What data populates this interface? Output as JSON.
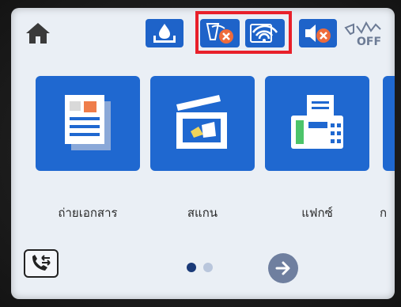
{
  "status_bar": {
    "home_icon": "home-icon",
    "ink_icon": "ink-level-icon",
    "wifi_direct_icon": "wifi-direct-disconnected-icon",
    "wifi_icon": "wifi-icon",
    "fax_sound_icon": "fax-sound-disabled-icon",
    "fax_off_label": "OFF"
  },
  "tiles": [
    {
      "label": "ถ่ายเอกสาร",
      "icon": "copy-icon"
    },
    {
      "label": "สแกน",
      "icon": "scan-icon"
    },
    {
      "label": "แฟกซ์",
      "icon": "fax-icon"
    },
    {
      "label": "ก",
      "icon": "partial-tile"
    }
  ],
  "bottom": {
    "fax_send_icon": "fax-send-icon",
    "page_indicator": {
      "current": 1,
      "total": 2
    },
    "next_icon": "arrow-right-icon"
  },
  "colors": {
    "tile_blue": "#1f68d0",
    "highlight_red": "#e8202a",
    "screen_bg": "#eaeff5"
  }
}
